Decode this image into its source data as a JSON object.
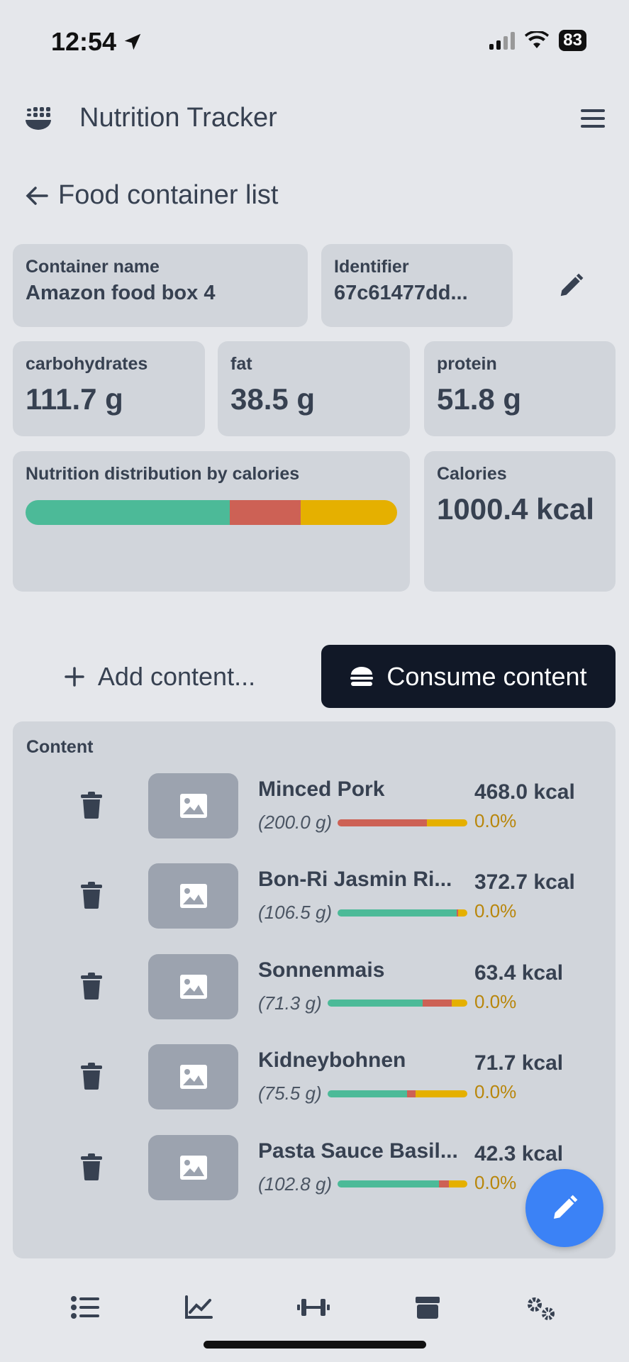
{
  "status": {
    "time": "12:54",
    "battery": "83"
  },
  "header": {
    "title": "Nutrition Tracker"
  },
  "back": {
    "label": "Food container list"
  },
  "container": {
    "name_label": "Container name",
    "name": "Amazon food box 4",
    "id_label": "Identifier",
    "id": "67c61477dd..."
  },
  "macros": [
    {
      "label": "carbohydrates",
      "value": "111.7 g"
    },
    {
      "label": "fat",
      "value": "38.5 g"
    },
    {
      "label": "protein",
      "value": "51.8 g"
    }
  ],
  "distribution": {
    "label": "Nutrition distribution by calories",
    "fractions": {
      "carbohydrates": 0.55,
      "fat": 0.19,
      "protein": 0.26
    }
  },
  "calories": {
    "label": "Calories",
    "value": "1000.4 kcal"
  },
  "colors": {
    "carbohydrates": "#4cba98",
    "fat": "#cd6155",
    "protein": "#e5b000",
    "fab": "#3b82f6",
    "consume_bg": "#111827"
  },
  "actions": {
    "add": "Add content...",
    "consume": "Consume content"
  },
  "content": {
    "title": "Content",
    "items": [
      {
        "name": "Minced Pork",
        "grams": "(200.0 g)",
        "kcal": "468.0 kcal",
        "pct": "0.0%",
        "bar": [
          0,
          0.69,
          0.31
        ]
      },
      {
        "name": "Bon-Ri Jasmin Ri...",
        "grams": "(106.5 g)",
        "kcal": "372.7 kcal",
        "pct": "0.0%",
        "bar": [
          0.92,
          0.01,
          0.07
        ]
      },
      {
        "name": "Sonnenmais",
        "grams": "(71.3 g)",
        "kcal": "63.4 kcal",
        "pct": "0.0%",
        "bar": [
          0.68,
          0.21,
          0.11
        ]
      },
      {
        "name": "Kidneybohnen",
        "grams": "(75.5 g)",
        "kcal": "71.7 kcal",
        "pct": "0.0%",
        "bar": [
          0.57,
          0.06,
          0.37
        ]
      },
      {
        "name": "Pasta Sauce Basil...",
        "grams": "(102.8 g)",
        "kcal": "42.3 kcal",
        "pct": "0.0%",
        "bar": [
          0.78,
          0.08,
          0.14
        ]
      }
    ]
  },
  "nav": [
    "list-icon",
    "chart-line-icon",
    "dumbbell-icon",
    "box-icon",
    "gears-icon"
  ]
}
